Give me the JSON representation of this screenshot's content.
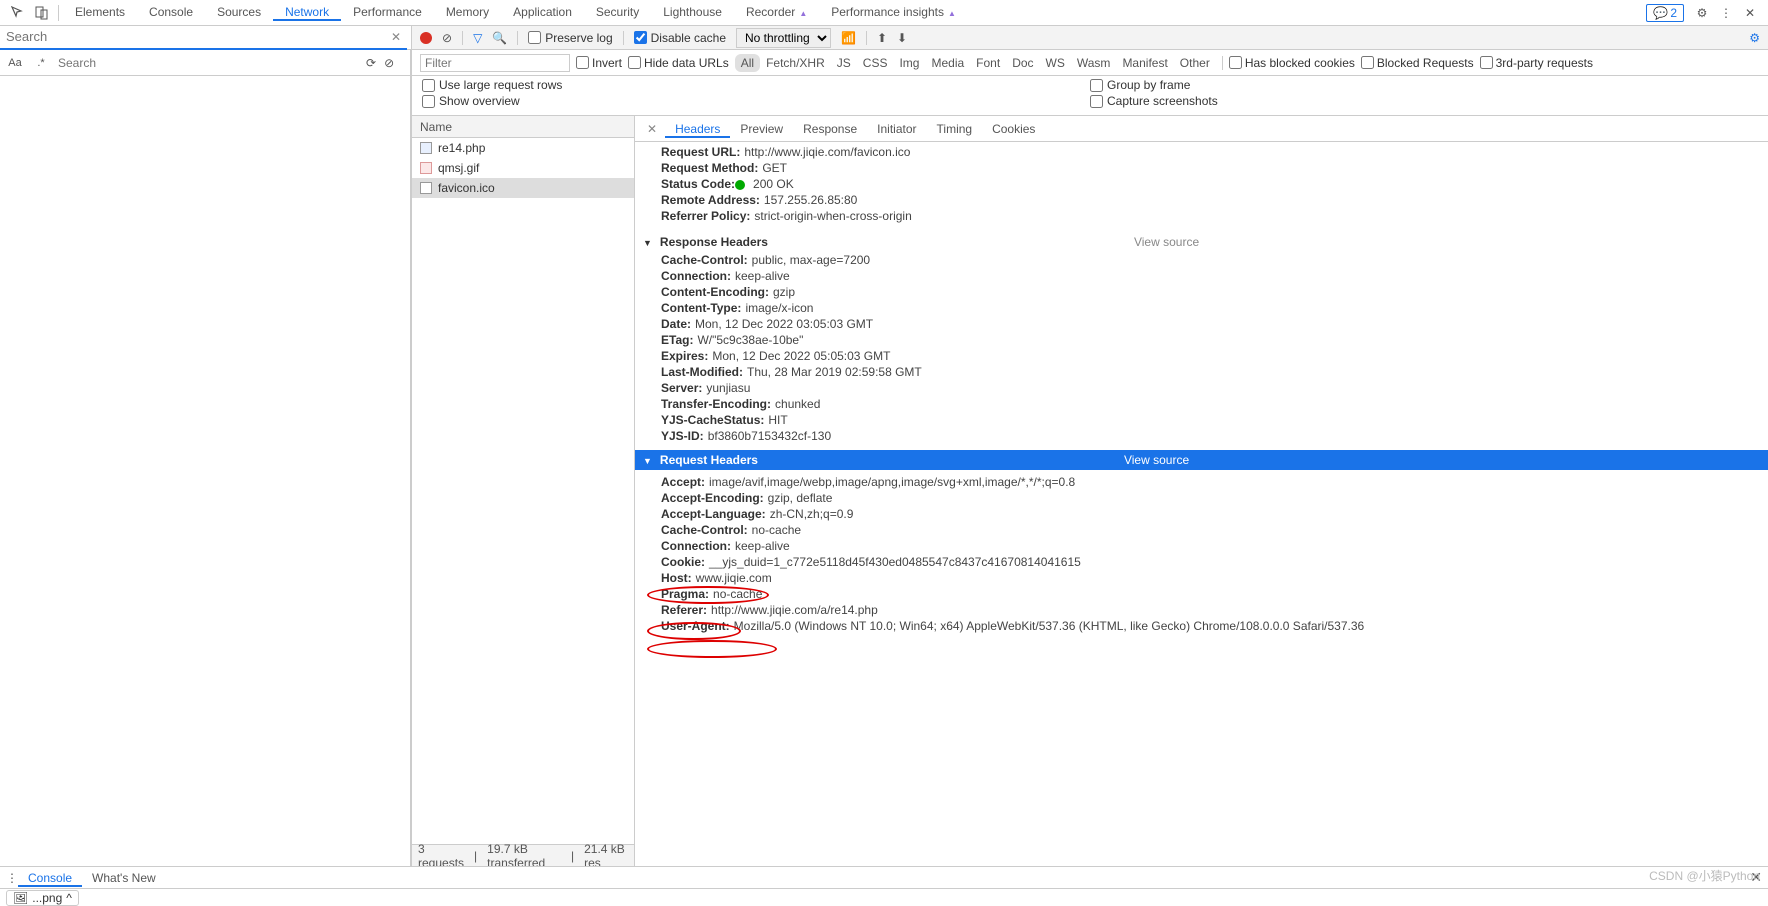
{
  "topTabs": {
    "items": [
      "Elements",
      "Console",
      "Sources",
      "Network",
      "Performance",
      "Memory",
      "Application",
      "Security",
      "Lighthouse",
      "Recorder",
      "Performance insights"
    ],
    "active": "Network",
    "issuesCount": "2"
  },
  "search": {
    "placeholder": "Search"
  },
  "regex": {
    "aa": "Aa",
    "re": ".*",
    "placeholder": "Search"
  },
  "netToolbar": {
    "preserveLog": "Preserve log",
    "disableCache": "Disable cache",
    "throttling": "No throttling"
  },
  "filterRow": {
    "filterPlaceholder": "Filter",
    "invert": "Invert",
    "hideDataUrls": "Hide data URLs",
    "types": [
      "All",
      "Fetch/XHR",
      "JS",
      "CSS",
      "Img",
      "Media",
      "Font",
      "Doc",
      "WS",
      "Wasm",
      "Manifest",
      "Other"
    ],
    "activeType": "All",
    "blockedCookies": "Has blocked cookies",
    "blockedReq": "Blocked Requests",
    "thirdParty": "3rd-party requests"
  },
  "opts": {
    "largeRows": "Use large request rows",
    "showOverview": "Show overview",
    "groupFrame": "Group by frame",
    "captureSS": "Capture screenshots"
  },
  "reqList": {
    "header": "Name",
    "rows": [
      {
        "icon": "php",
        "name": "re14.php"
      },
      {
        "icon": "gif",
        "name": "qmsj.gif"
      },
      {
        "icon": "ico",
        "name": "favicon.ico"
      }
    ],
    "selected": 2,
    "summary": {
      "requests": "3 requests",
      "transferred": "19.7 kB transferred",
      "resources": "21.4 kB res"
    }
  },
  "detTabs": {
    "items": [
      "Headers",
      "Preview",
      "Response",
      "Initiator",
      "Timing",
      "Cookies"
    ],
    "active": "Headers"
  },
  "general": [
    {
      "k": "Request URL:",
      "v": "http://www.jiqie.com/favicon.ico"
    },
    {
      "k": "Request Method:",
      "v": "GET"
    },
    {
      "k": "Status Code:",
      "v": "200 OK",
      "dot": true
    },
    {
      "k": "Remote Address:",
      "v": "157.255.26.85:80"
    },
    {
      "k": "Referrer Policy:",
      "v": "strict-origin-when-cross-origin"
    }
  ],
  "sections": {
    "response": "Response Headers",
    "request": "Request Headers",
    "viewSource": "View source"
  },
  "responseHeaders": [
    {
      "k": "Cache-Control:",
      "v": "public, max-age=7200"
    },
    {
      "k": "Connection:",
      "v": "keep-alive"
    },
    {
      "k": "Content-Encoding:",
      "v": "gzip"
    },
    {
      "k": "Content-Type:",
      "v": "image/x-icon"
    },
    {
      "k": "Date:",
      "v": "Mon, 12 Dec 2022 03:05:03 GMT"
    },
    {
      "k": "ETag:",
      "v": "W/\"5c9c38ae-10be\""
    },
    {
      "k": "Expires:",
      "v": "Mon, 12 Dec 2022 05:05:03 GMT"
    },
    {
      "k": "Last-Modified:",
      "v": "Thu, 28 Mar 2019 02:59:58 GMT"
    },
    {
      "k": "Server:",
      "v": "yunjiasu"
    },
    {
      "k": "Transfer-Encoding:",
      "v": "chunked"
    },
    {
      "k": "YJS-CacheStatus:",
      "v": "HIT"
    },
    {
      "k": "YJS-ID:",
      "v": "bf3860b7153432cf-130"
    }
  ],
  "requestHeaders": [
    {
      "k": "Accept:",
      "v": "image/avif,image/webp,image/apng,image/svg+xml,image/*,*/*;q=0.8"
    },
    {
      "k": "Accept-Encoding:",
      "v": "gzip, deflate"
    },
    {
      "k": "Accept-Language:",
      "v": "zh-CN,zh;q=0.9"
    },
    {
      "k": "Cache-Control:",
      "v": "no-cache"
    },
    {
      "k": "Connection:",
      "v": "keep-alive"
    },
    {
      "k": "Cookie:",
      "v": "__yjs_duid=1_c772e5118d45f430ed0485547c8437c41670814041615"
    },
    {
      "k": "Host:",
      "v": "www.jiqie.com"
    },
    {
      "k": "Pragma:",
      "v": "no-cache"
    },
    {
      "k": "Referer:",
      "v": "http://www.jiqie.com/a/re14.php"
    },
    {
      "k": "User-Agent:",
      "v": "Mozilla/5.0 (Windows NT 10.0; Win64; x64) AppleWebKit/537.36 (KHTML, like Gecko) Chrome/108.0.0.0 Safari/537.36"
    }
  ],
  "drawer": {
    "tabs": [
      "Console",
      "What's New"
    ],
    "active": "Console"
  },
  "download": {
    "name": "...png"
  },
  "watermark": "CSDN @小猿Python"
}
